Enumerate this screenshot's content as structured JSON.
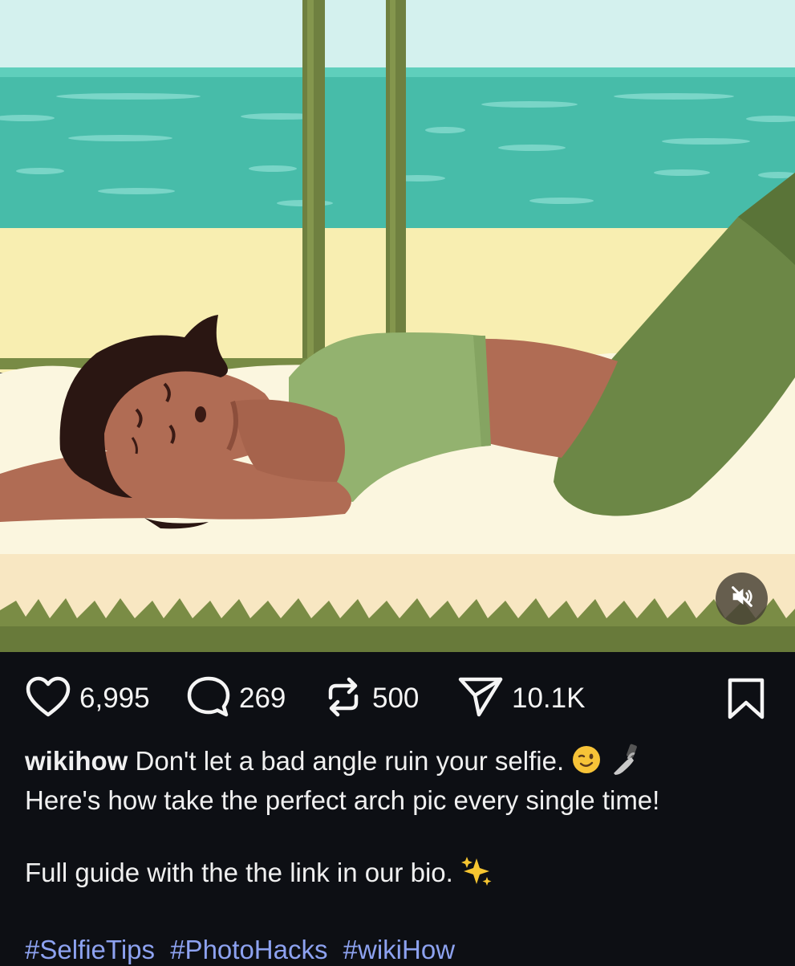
{
  "post": {
    "likes": "6,995",
    "comments": "269",
    "reposts": "500",
    "shares": "10.1K",
    "username": "wikihow",
    "caption_line1": "Don't let a bad angle ruin your selfie.",
    "caption_line2": "Here's how take the perfect arch pic every single time!",
    "caption_para2": "Full guide with the the link in our bio.",
    "hashtags": [
      "#SelfieTips",
      "#PhotoHacks",
      "#wikiHow"
    ]
  },
  "icons": {
    "like": "heart-outline-icon",
    "comment": "speech-bubble-icon",
    "repost": "repost-arrows-icon",
    "share": "paper-plane-icon",
    "bookmark": "bookmark-outline-icon",
    "mute": "speaker-muted-icon",
    "emoji_wink": "winking-face-emoji",
    "emoji_selfie": "selfie-hand-emoji",
    "emoji_sparkles": "sparkles-emoji"
  },
  "colors": {
    "background": "#0d0f14",
    "hashtag": "#8da2f0",
    "text": "#f0f0f0"
  }
}
